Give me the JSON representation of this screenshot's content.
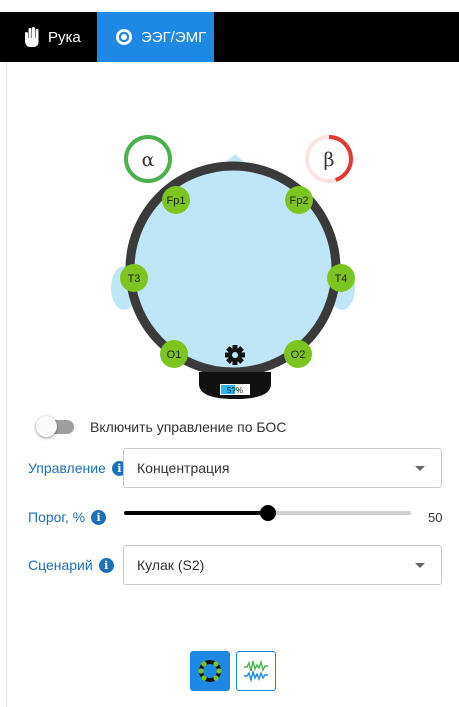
{
  "tabs": [
    {
      "label": "Рука",
      "icon": "hand-icon",
      "active": false
    },
    {
      "label": "ЭЭГ/ЭМГ",
      "icon": "target-icon",
      "active": true
    }
  ],
  "indicators": {
    "alpha": {
      "symbol": "α",
      "color": "#4caf50",
      "level": 1.0
    },
    "beta": {
      "symbol": "β",
      "color": "#e53935",
      "level": 0.45
    }
  },
  "electrodes": [
    "Fp1",
    "Fp2",
    "T3",
    "T4",
    "O1",
    "O2"
  ],
  "electrode_color": "#7cc520",
  "battery_text": "5?%",
  "toggle": {
    "label": "Включить управление по БОС",
    "on": false
  },
  "control": {
    "label": "Управление",
    "value": "Концентрация"
  },
  "threshold": {
    "label": "Порог, %",
    "value": "50",
    "fraction": 0.5
  },
  "scenario": {
    "label": "Сценарий",
    "value": "Кулак (S2)"
  },
  "bottom_buttons": [
    {
      "icon": "electrodes-icon",
      "active": true
    },
    {
      "icon": "signal-icon",
      "active": false
    }
  ],
  "colors": {
    "accent": "#1e88e5",
    "label": "#1e6fb8",
    "head": "#bfe6f7",
    "band": "#3a3a3a"
  }
}
